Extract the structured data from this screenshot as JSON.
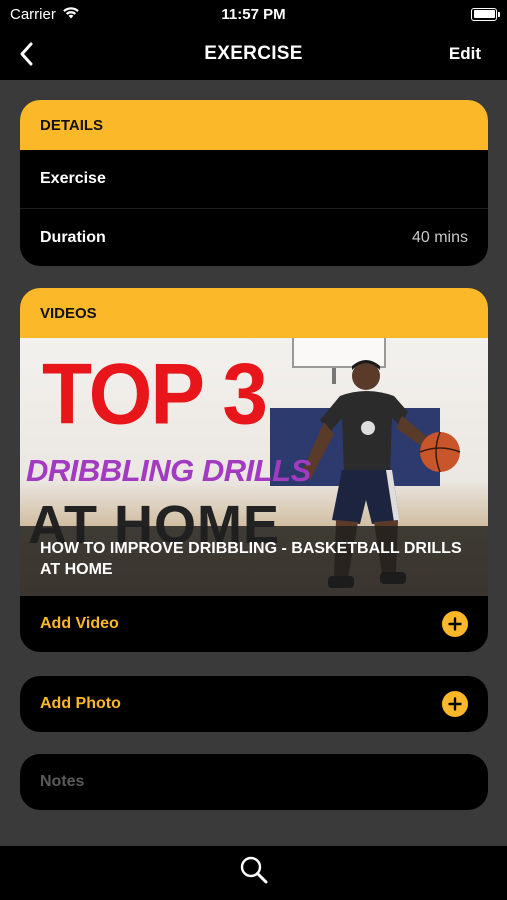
{
  "status_bar": {
    "carrier": "Carrier",
    "time": "11:57 PM"
  },
  "nav": {
    "title": "EXERCISE",
    "edit_label": "Edit"
  },
  "details": {
    "header": "DETAILS",
    "rows": [
      {
        "label": "Exercise",
        "value": ""
      },
      {
        "label": "Duration",
        "value": "40 mins"
      }
    ]
  },
  "videos": {
    "header": "VIDEOS",
    "items": [
      {
        "thumbnail_text": {
          "line1": "TOP 3",
          "line2": "DRIBBLING DRILLS",
          "line3": "AT HOME"
        },
        "title": "HOW TO IMPROVE DRIBBLING - BASKETBALL DRILLS AT HOME"
      }
    ],
    "add_label": "Add Video"
  },
  "photo": {
    "add_label": "Add Photo"
  },
  "notes": {
    "placeholder": "Notes"
  },
  "tab_bar": {
    "icons": [
      "search-icon"
    ]
  },
  "colors": {
    "accent": "#fbb829",
    "background": "#3a3a3a",
    "card": "#000000"
  }
}
